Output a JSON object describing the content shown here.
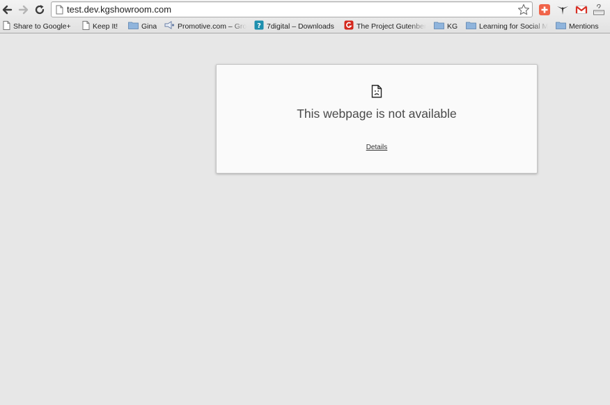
{
  "browser": {
    "url": "test.dev.kgshowroom.com"
  },
  "bookmarks": [
    {
      "label": "Share to Google+",
      "icon": "page-icon"
    },
    {
      "label": "Keep It!",
      "icon": "page-icon"
    },
    {
      "label": "Gina",
      "icon": "folder-icon"
    },
    {
      "label": "Promotive.com – Grow Your Brand",
      "icon": "promotive-icon"
    },
    {
      "label": "7digital – Downloads",
      "icon": "7digital-icon"
    },
    {
      "label": "The Project Gutenberg",
      "icon": "gutenberg-icon"
    },
    {
      "label": "KG",
      "icon": "folder-icon"
    },
    {
      "label": "Learning for Social Media",
      "icon": "folder-icon"
    },
    {
      "label": "Mentions",
      "icon": "folder-icon"
    }
  ],
  "error": {
    "title": "This webpage is not available",
    "details_label": "Details"
  },
  "colors": {
    "page_background": "#e7e7e7",
    "card_background": "#fafafa",
    "folder_blue": "#8fb4dc"
  }
}
